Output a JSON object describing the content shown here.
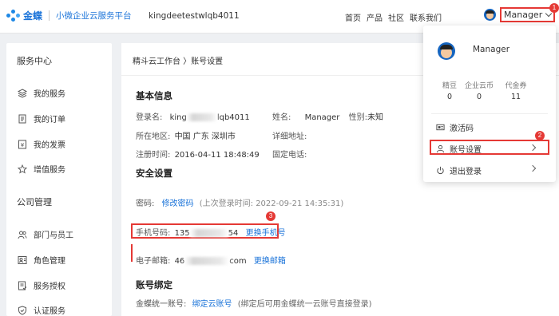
{
  "header": {
    "brand": "金蝶",
    "subtitle": "小微企业云服务平台",
    "account": "kingdeetestwlqb4011",
    "nav": [
      "首页",
      "产品",
      "社区",
      "联系我们"
    ],
    "user": "Manager",
    "badges": [
      "1",
      "2",
      "3"
    ]
  },
  "sidebar": {
    "section1": "服务中心",
    "items1": [
      {
        "label": "我的服务",
        "icon": "layers-icon"
      },
      {
        "label": "我的订单",
        "icon": "document-icon"
      },
      {
        "label": "我的发票",
        "icon": "invoice-icon"
      },
      {
        "label": "增值服务",
        "icon": "star-icon"
      }
    ],
    "section2": "公司管理",
    "items2": [
      {
        "label": "部门与员工",
        "icon": "people-icon"
      },
      {
        "label": "角色管理",
        "icon": "role-icon"
      },
      {
        "label": "服务授权",
        "icon": "authorize-icon"
      },
      {
        "label": "认证服务",
        "icon": "shield-icon"
      }
    ]
  },
  "main": {
    "breadcrumb": "精斗云工作台 〉账号设置",
    "basic_title": "基本信息",
    "login_label": "登录名:",
    "login_value_prefix": "king",
    "login_value_suffix": "lqb4011",
    "name_label": "姓名:",
    "name_value": "Manager",
    "gender_label": "性别:",
    "gender_value": "未知",
    "region_label": "所在地区:",
    "region_value": "中国 广东 深圳市",
    "address_label": "详细地址:",
    "reg_label": "注册时间:",
    "reg_value": "2016-04-11 18:48:49",
    "phone_fixed_label": "固定电话:",
    "security_title": "安全设置",
    "password_label": "密码:",
    "password_link": "修改密码",
    "password_note": "(上次登录时间: 2022-09-21 14:35:31)",
    "mobile_label": "手机号码:",
    "mobile_prefix": "135",
    "mobile_suffix": "54",
    "mobile_link": "更换手机号",
    "email_label": "电子邮箱:",
    "email_prefix": "46",
    "email_suffix": "com",
    "email_link": "更换邮箱",
    "binding_title": "账号绑定",
    "kingdee_label": "金蝶统一账号:",
    "kingdee_link": "绑定云账号",
    "kingdee_note": "(绑定后可用金蝶统一云账号直接登录)"
  },
  "dropdown": {
    "name": "Manager",
    "stats": [
      {
        "label": "精豆",
        "value": "0"
      },
      {
        "label": "企业云币",
        "value": "0"
      },
      {
        "label": "代金券",
        "value": "11"
      }
    ],
    "items": [
      {
        "label": "激活码",
        "icon": "activation-code-icon"
      },
      {
        "label": "账号设置",
        "icon": "user-icon"
      },
      {
        "label": "退出登录",
        "icon": "power-icon"
      }
    ]
  },
  "colors": {
    "accent": "#1a73d9",
    "highlight": "#e53935"
  }
}
